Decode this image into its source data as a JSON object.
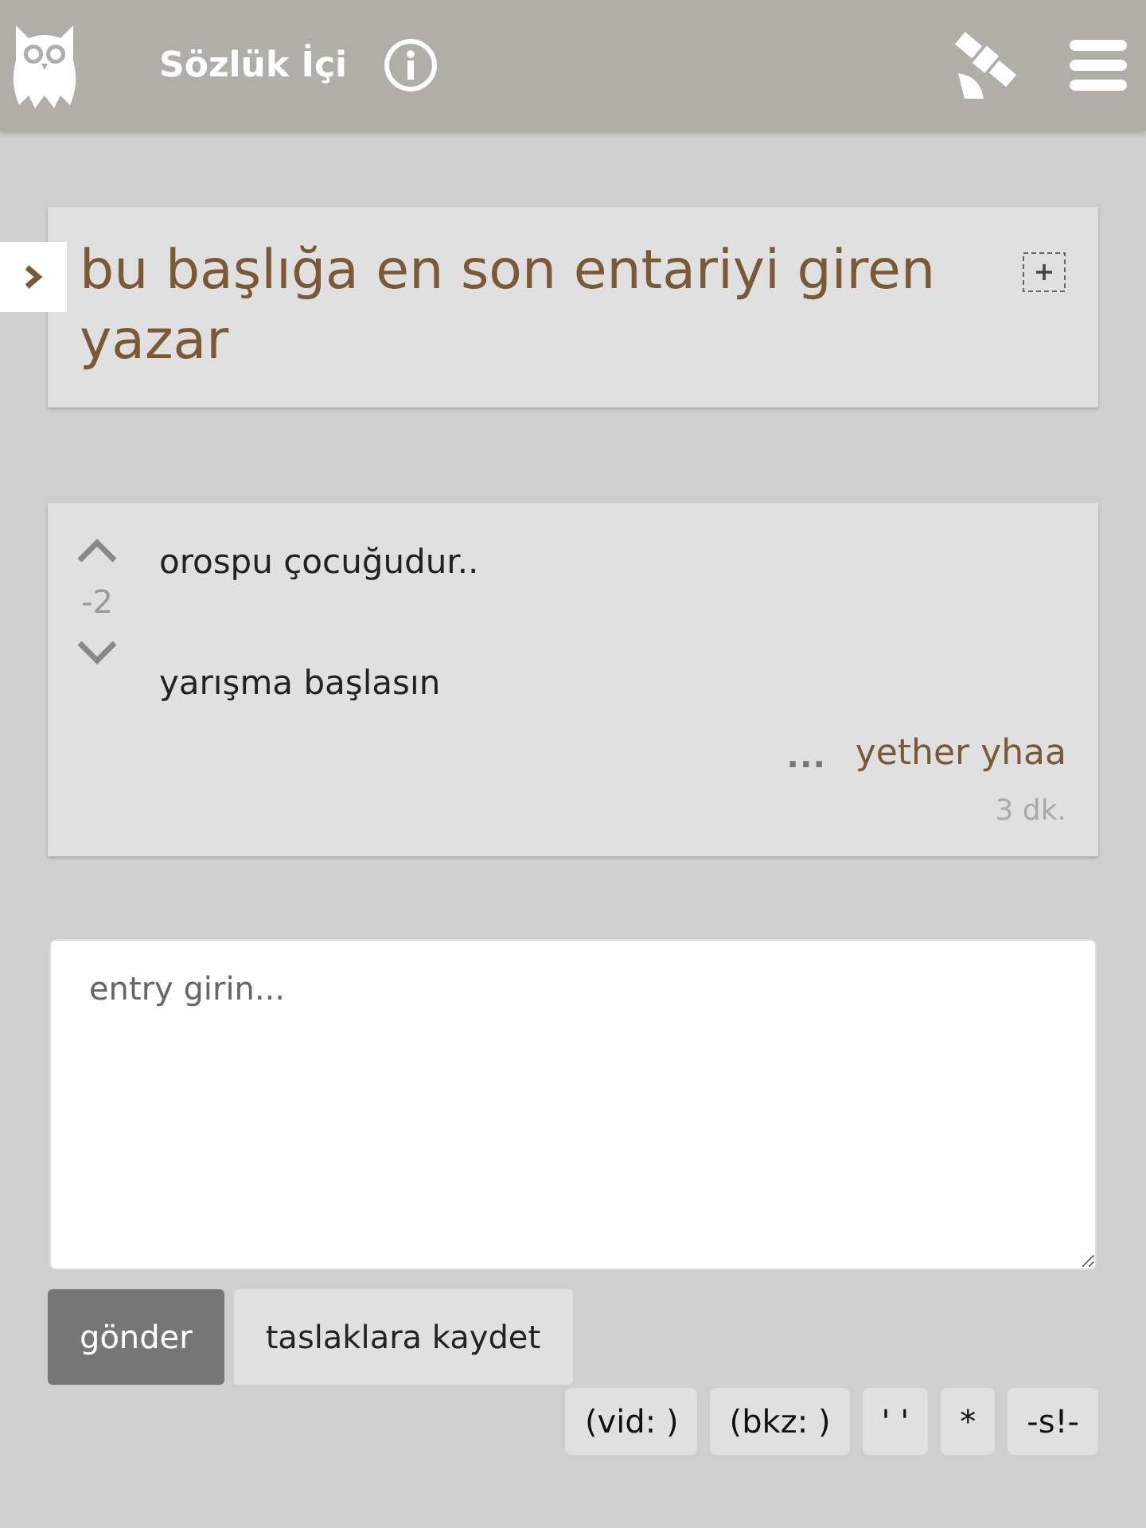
{
  "header": {
    "title": "Sözlük İçi"
  },
  "topic": {
    "title": "bu başlığa en son entariyi giren yazar"
  },
  "entry": {
    "score": "-2",
    "lines": [
      "orospu çocuğudur..",
      "yarışma başlasın"
    ],
    "more": "…",
    "author": "yether yhaa",
    "time": "3 dk."
  },
  "editor": {
    "placeholder": "entry girin..."
  },
  "actions": [
    {
      "label": "gönder",
      "kind": "primary"
    },
    {
      "label": "taslaklara kaydet",
      "kind": "secondary"
    }
  ],
  "format_buttons": [
    "(vid: )",
    "(bkz: )",
    "' '",
    "*",
    "-s!-"
  ]
}
